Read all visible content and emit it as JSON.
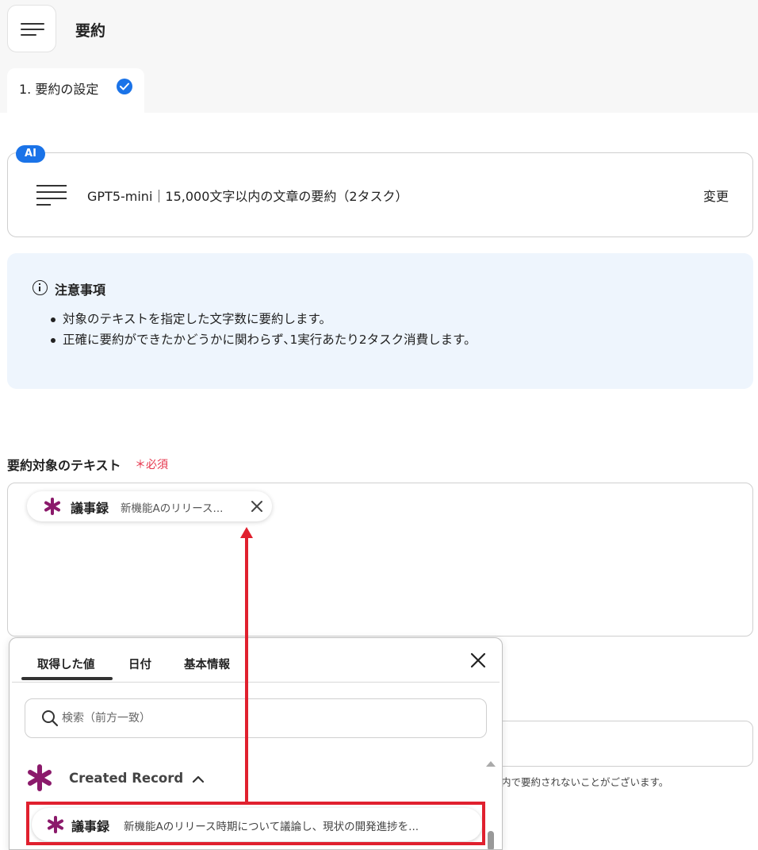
{
  "header": {
    "title": "要約",
    "step_tab": "1. 要約の設定"
  },
  "model": {
    "badge": "AI",
    "name": "GPT5-mini｜15,000文字以内の文章の要約（2タスク）",
    "change_label": "変更"
  },
  "notice": {
    "title": "注意事項",
    "items": [
      "対象のテキストを指定した文字数に要約します。",
      "正確に要約ができたかどうかに関わらず､1実行あたり2タスク消費します。"
    ]
  },
  "field": {
    "label": "要約対象のテキスト",
    "required": "＊必須",
    "chip_title": "議事録",
    "chip_value": "新機能Aのリリース..."
  },
  "hint": "内で要約されないことがございます。",
  "popup": {
    "tabs": [
      "取得した値",
      "日付",
      "基本情報"
    ],
    "search_placeholder": "検索（前方一致）",
    "group_title": "Created Record",
    "row_title": "議事録",
    "row_value": "新機能Aのリリース時期について議論し、現状の開発進捗を..."
  },
  "colors": {
    "accent_blue": "#1a73e8",
    "required_red": "#e5344b",
    "annotation_red": "#e0202e",
    "app_icon_purple": "#8b1a6b",
    "notice_bg": "#eef5fd"
  }
}
